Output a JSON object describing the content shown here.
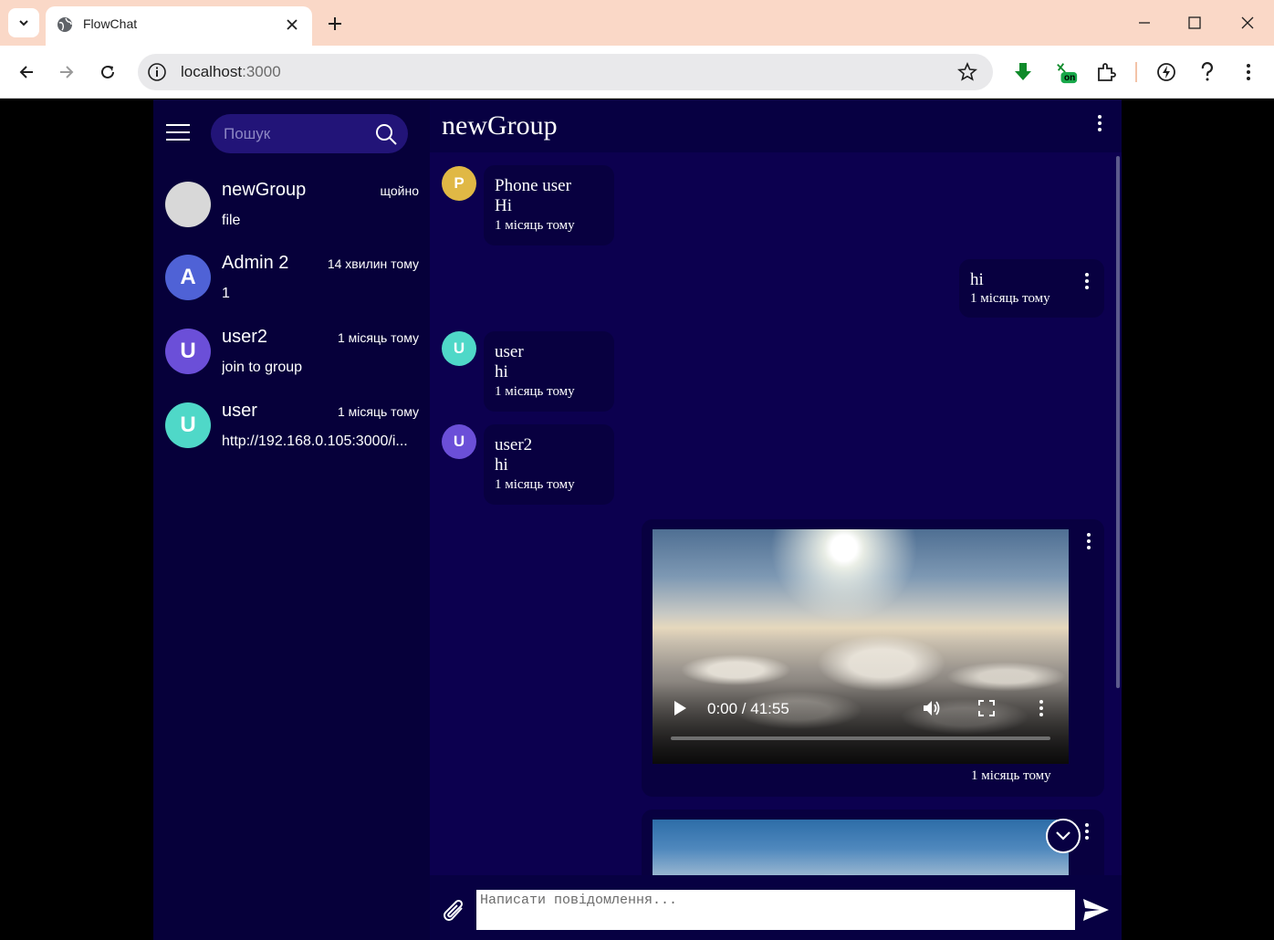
{
  "browser": {
    "tab_title": "FlowChat",
    "url_host": "localhost",
    "url_port": ":3000",
    "ext_badge": "on"
  },
  "sidebar": {
    "search_placeholder": "Пошук",
    "chats": [
      {
        "name": "newGroup",
        "time": "щойно",
        "last": "file",
        "initial": "",
        "color": "#d8d8d8"
      },
      {
        "name": "Admin 2",
        "time": "14 хвилин тому",
        "last": "1",
        "initial": "A",
        "color": "#4f62d6"
      },
      {
        "name": "user2",
        "time": "1 місяць тому",
        "last": "join to group",
        "initial": "U",
        "color": "#6b4fd8"
      },
      {
        "name": "user",
        "time": "1 місяць тому",
        "last": "http://192.168.0.105:3000/i...",
        "initial": "U",
        "color": "#4fd8c8"
      }
    ]
  },
  "chat": {
    "title": "newGroup",
    "messages": [
      {
        "author": "Phone user",
        "text": "Hi",
        "time": "1 місяць тому",
        "initial": "P",
        "color": "#e0b845"
      },
      {
        "author": "",
        "text": "hi",
        "time": "1 місяць тому"
      },
      {
        "author": "user",
        "text": "hi",
        "time": "1 місяць тому",
        "initial": "U",
        "color": "#4fd8c8"
      },
      {
        "author": "user2",
        "text": "hi",
        "time": "1 місяць тому",
        "initial": "U",
        "color": "#6b4fd8"
      },
      {
        "video_time": "0:00 / 41:55",
        "time": "1 місяць тому"
      }
    ],
    "composer_placeholder": "Написати повідомлення..."
  }
}
